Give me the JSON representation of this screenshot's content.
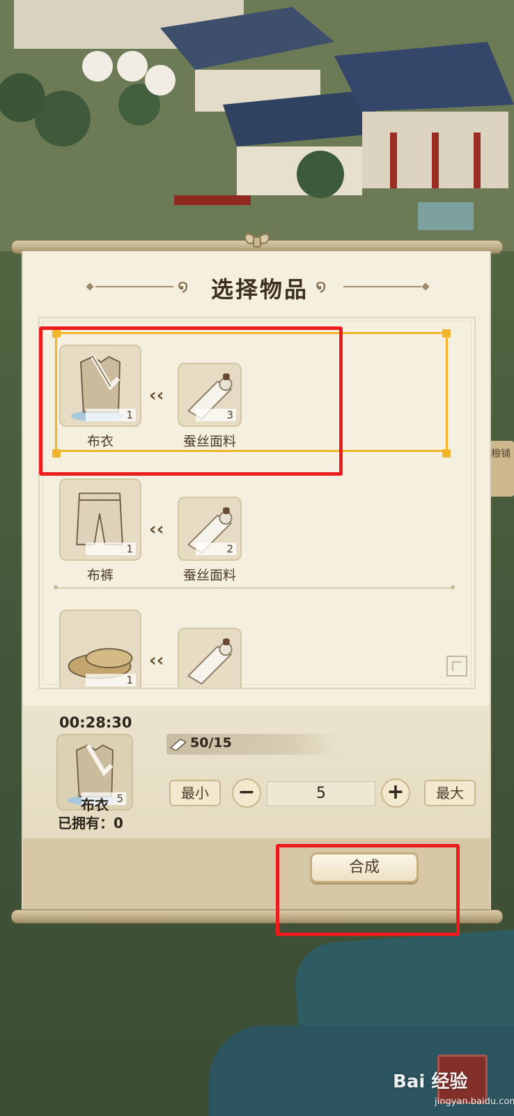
{
  "dialog": {
    "title": "选择物品"
  },
  "recipes": [
    {
      "product": {
        "name": "布衣",
        "count": "1"
      },
      "material": {
        "name": "蚕丝面料",
        "count": "3"
      },
      "selected": true
    },
    {
      "product": {
        "name": "布裤",
        "count": "1"
      },
      "material": {
        "name": "蚕丝面料",
        "count": "2"
      },
      "selected": false
    },
    {
      "product": {
        "name": "",
        "count": "1"
      },
      "material": {
        "name": "",
        "count": ""
      },
      "selected": false
    }
  ],
  "craft": {
    "timer": "00:28:30",
    "product_name": "布衣",
    "product_count": "5",
    "owned_label": "已拥有：0",
    "material_count": "50/15",
    "min_label": "最小",
    "max_label": "最大",
    "minus_label": "−",
    "plus_label": "+",
    "quantity": "5",
    "synthesize_label": "合成"
  },
  "background": {
    "side_sign": "粮铺"
  },
  "watermark": {
    "text": "Bai 经验",
    "sub": "jingyan.baidu.com"
  },
  "colors": {
    "selection": "#f0b52a",
    "annotation": "#ec1c1c",
    "paper": "#f4efdf"
  }
}
